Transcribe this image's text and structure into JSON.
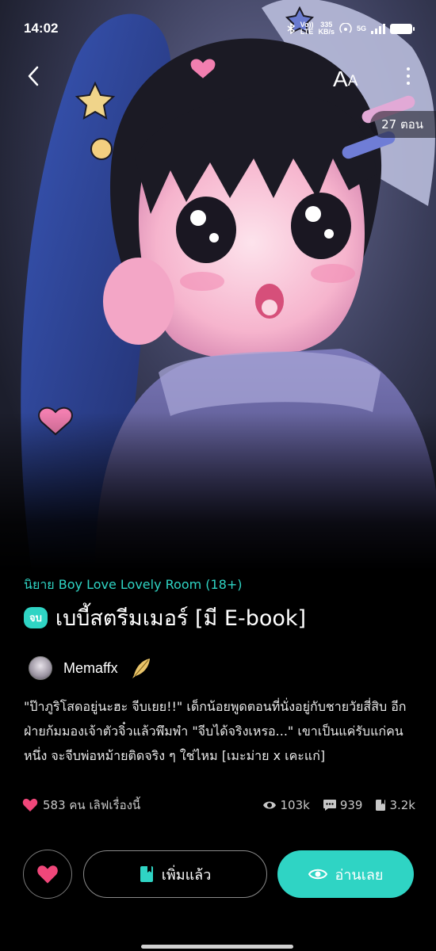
{
  "status_bar": {
    "time": "14:02",
    "volte_top": "Vo))",
    "volte_bottom": "LTE",
    "speed_value": "335",
    "speed_unit": "KB/s",
    "network": "5G"
  },
  "header": {
    "font_size_label_big": "A",
    "font_size_label_small": "A",
    "episodes": "27 ตอน"
  },
  "novel": {
    "genre": "นิยาย Boy Love Lovely Room  (18+)",
    "end_badge": "จบ",
    "title": "เบบี้สตรีมเมอร์ [มี E-book]",
    "author": "Memaffx",
    "description": "\"ป๊าภูริโสดอยู่นะฮะ จีบเยย!!\" เด็กน้อยพูดตอนที่นั่งอยู่กับชายวัยสี่สิบ อีกฝ่ายก้มมองเจ้าตัวจิ๋วแล้วพึมพำ \"จีบได้จริงเหรอ...\" เขาเป็นแค่รับแก่คนหนึ่ง จะจีบพ่อหม้ายติดจริง ๆ ใช่ไหม [เมะม่าย x เคะแก่]"
  },
  "stats": {
    "likes": "583 คน เลิฟเรื่องนี้",
    "views": "103k",
    "comments": "939",
    "bookmarks": "3.2k"
  },
  "actions": {
    "added_label": "เพิ่มแล้ว",
    "read_label": "อ่านเลย"
  },
  "colors": {
    "accent": "#2fd4c4",
    "heart": "#f0477a",
    "background": "#000000"
  },
  "icons": {
    "back": "chevron-left-icon",
    "more": "more-vertical-icon",
    "author_badge": "feather-icon",
    "like": "heart-icon",
    "views": "eye-icon",
    "comments": "comment-icon",
    "bookmarks": "book-icon"
  }
}
